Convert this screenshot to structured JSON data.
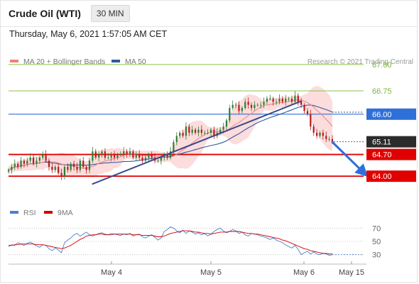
{
  "header": {
    "instrument": "Crude Oil (WTI)",
    "timeframe": "30 MIN"
  },
  "timestamp": "Thursday, May 6, 2021 1:57:05 AM CET",
  "copyright": "Research © 2021 Trading Central",
  "colors": {
    "ma20": "#f08080",
    "ma50": "#2f5a9e",
    "resistance_green": "#8cc14c",
    "pivot_blue": "#2f6fd8",
    "support_red": "#e00000",
    "last_price_tag": "#2b2b2b",
    "band_fill": "#fbd0d0",
    "candle_up": "#2e7d32",
    "candle_down": "#b71c1c"
  },
  "chart_data": [
    {
      "type": "line",
      "title": "Crude Oil (WTI)",
      "legend": [
        {
          "name": "MA 20 + Bollinger Bands",
          "color": "#f08080"
        },
        {
          "name": "MA 50",
          "color": "#2f5a9e"
        }
      ],
      "x_ticks": [
        "May 4",
        "May 5",
        "May 6",
        "May 15"
      ],
      "ylim": [
        63.5,
        67.85
      ],
      "price_levels": [
        {
          "value": 67.6,
          "label": "67.60",
          "kind": "resistance"
        },
        {
          "value": 66.75,
          "label": "66.75",
          "kind": "resistance"
        },
        {
          "value": 66.0,
          "label": "66.00",
          "kind": "pivot"
        },
        {
          "value": 65.11,
          "label": "65.11",
          "kind": "last"
        },
        {
          "value": 64.7,
          "label": "64.70",
          "kind": "support"
        },
        {
          "value": 64.0,
          "label": "64.00",
          "kind": "support"
        }
      ],
      "close_series": [
        64.2,
        64.3,
        64.4,
        64.3,
        64.5,
        64.4,
        64.5,
        64.6,
        64.4,
        64.5,
        64.6,
        64.7,
        64.5,
        64.3,
        64.2,
        64.3,
        64.1,
        64.0,
        64.3,
        64.2,
        64.4,
        64.3,
        64.2,
        64.5,
        64.3,
        64.2,
        64.5,
        64.8,
        64.6,
        64.7,
        64.8,
        64.6,
        64.6,
        64.7,
        64.6,
        64.7,
        64.7,
        64.8,
        64.7,
        64.8,
        64.6,
        64.7,
        64.6,
        64.5,
        64.6,
        64.7,
        64.6,
        64.5,
        64.5,
        64.6,
        64.7,
        64.6,
        64.8,
        65.1,
        65.3,
        65.4,
        65.3,
        65.6,
        65.4,
        65.5,
        65.4,
        65.5,
        65.4,
        65.4,
        65.4,
        65.5,
        65.3,
        65.4,
        65.5,
        65.6,
        65.8,
        66.2,
        66.3,
        66.3,
        66.1,
        66.2,
        66.4,
        66.3,
        66.2,
        66.3,
        66.3,
        66.3,
        66.4,
        66.5,
        66.5,
        66.4,
        66.4,
        66.5,
        66.4,
        66.5,
        66.5,
        66.4,
        66.6,
        66.4,
        66.3,
        66.1,
        66.0,
        65.6,
        65.4,
        65.3,
        65.4,
        65.3,
        65.2,
        65.2,
        65.1
      ],
      "trendlines": [
        {
          "from": {
            "bar": 27,
            "value": 63.75
          },
          "to": {
            "bar": 94,
            "value": 66.42
          }
        },
        {
          "from": {
            "bar": 104,
            "value": 65.1
          },
          "to": {
            "bar": 114,
            "value": 64.12
          },
          "arrow": true
        }
      ]
    },
    {
      "type": "line",
      "title": "RSI",
      "legend": [
        {
          "name": "RSI",
          "color": "#4a80c8"
        },
        {
          "name": "9MA",
          "color": "#d00000"
        }
      ],
      "y_ticks": [
        "70",
        "50",
        "30"
      ],
      "ylim": [
        20,
        80
      ],
      "rsi": [
        42,
        45,
        44,
        48,
        46,
        44,
        47,
        49,
        46,
        43,
        41,
        45,
        44,
        39,
        36,
        40,
        37,
        33,
        48,
        52,
        55,
        60,
        62,
        58,
        61,
        64,
        60,
        58,
        60,
        62,
        63,
        61,
        60,
        62,
        61,
        60,
        59,
        61,
        60,
        62,
        58,
        60,
        61,
        57,
        55,
        58,
        60,
        56,
        52,
        55,
        65,
        68,
        72,
        70,
        66,
        63,
        67,
        62,
        66,
        64,
        61,
        63,
        60,
        62,
        58,
        61,
        65,
        68,
        70,
        66,
        63,
        65,
        68,
        66,
        62,
        64,
        60,
        58,
        62,
        61,
        60,
        58,
        57,
        55,
        53,
        55,
        52,
        50,
        48,
        45,
        42,
        40,
        44,
        38,
        30,
        33,
        35,
        31,
        34,
        31,
        30,
        32,
        31,
        29,
        30
      ],
      "ma9": [
        44,
        44,
        45,
        45,
        46,
        46,
        46,
        46,
        46,
        45,
        45,
        45,
        44,
        43,
        42,
        41,
        40,
        39,
        40,
        42,
        44,
        47,
        50,
        53,
        55,
        58,
        59,
        60,
        60,
        61,
        61,
        60,
        60,
        60,
        61,
        61,
        61,
        61,
        61,
        61,
        60,
        60,
        60,
        59,
        59,
        59,
        59,
        58,
        57,
        57,
        58,
        60,
        62,
        63,
        64,
        65,
        66,
        66,
        66,
        65,
        64,
        64,
        63,
        62,
        62,
        61,
        62,
        63,
        64,
        64,
        64,
        65,
        65,
        65,
        65,
        64,
        63,
        62,
        62,
        61,
        61,
        60,
        59,
        58,
        57,
        56,
        55,
        54,
        52,
        51,
        49,
        47,
        45,
        43,
        41,
        39,
        38,
        36,
        35,
        34,
        33,
        32,
        32,
        31,
        31
      ]
    }
  ]
}
